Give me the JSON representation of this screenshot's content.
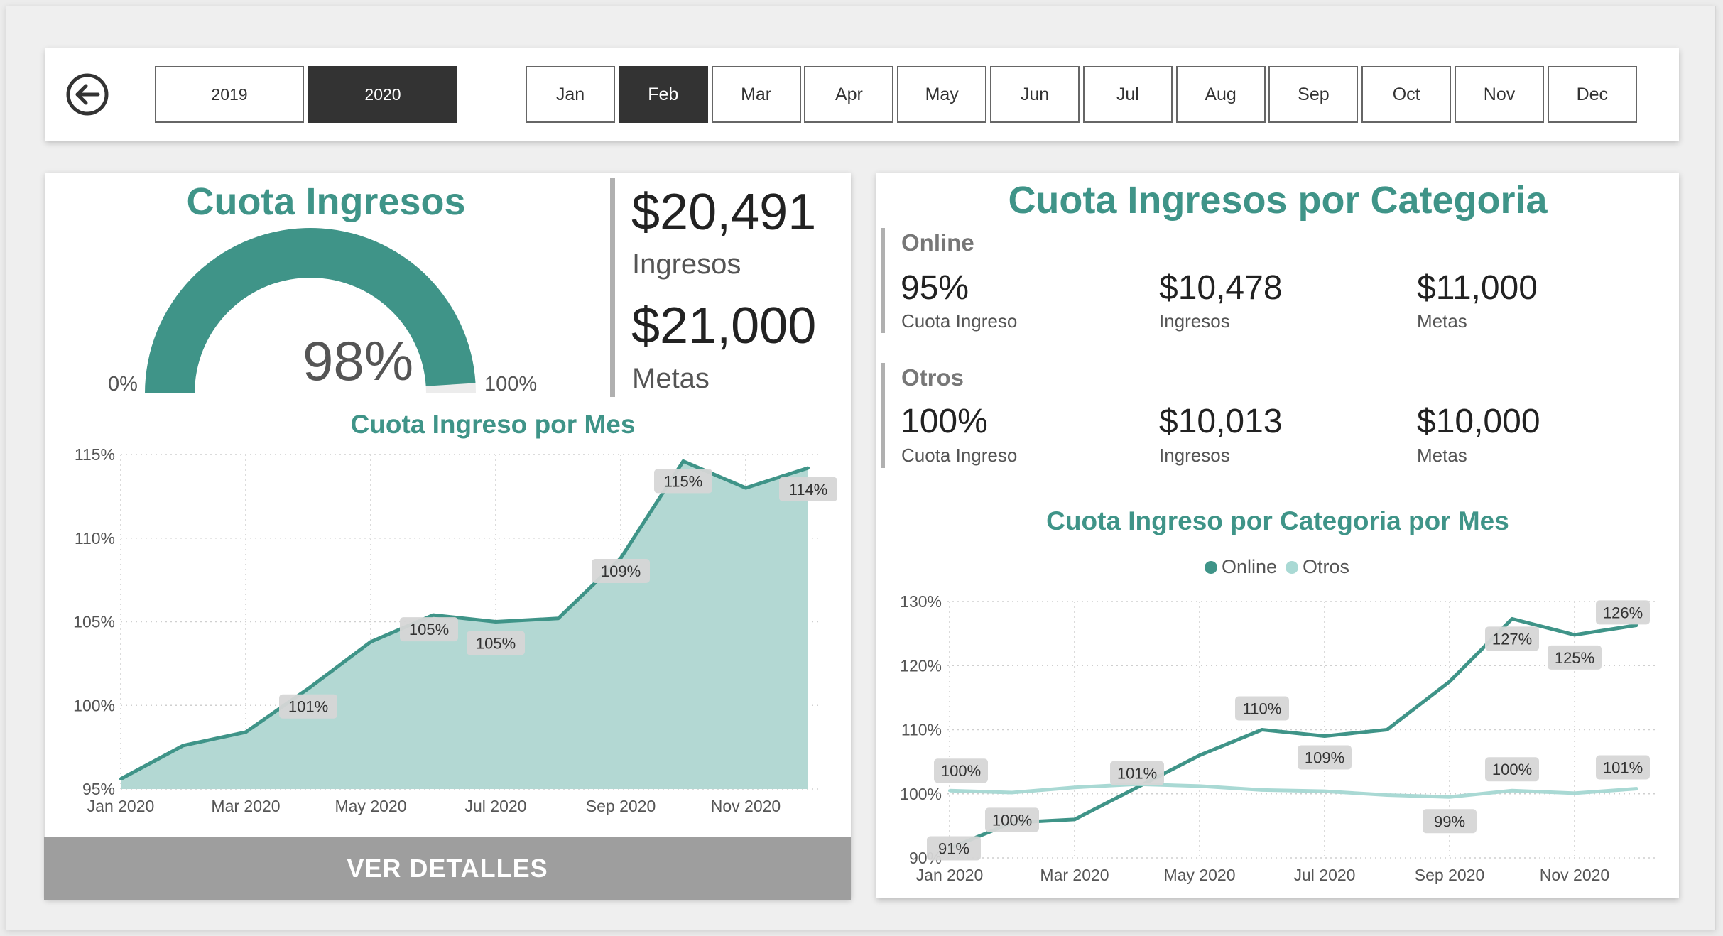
{
  "slicers": {
    "years": [
      {
        "label": "2019",
        "selected": false
      },
      {
        "label": "2020",
        "selected": true
      }
    ],
    "months": [
      {
        "label": "Jan",
        "selected": false
      },
      {
        "label": "Feb",
        "selected": true
      },
      {
        "label": "Mar",
        "selected": false
      },
      {
        "label": "Apr",
        "selected": false
      },
      {
        "label": "May",
        "selected": false
      },
      {
        "label": "Jun",
        "selected": false
      },
      {
        "label": "Jul",
        "selected": false
      },
      {
        "label": "Aug",
        "selected": false
      },
      {
        "label": "Sep",
        "selected": false
      },
      {
        "label": "Oct",
        "selected": false
      },
      {
        "label": "Nov",
        "selected": false
      },
      {
        "label": "Dec",
        "selected": false
      }
    ],
    "back_icon": "arrow-left-circle-icon"
  },
  "left": {
    "title": "Cuota Ingresos",
    "gauge": {
      "value_label": "98%",
      "value": 0.98,
      "min_label": "0%",
      "max_label": "100%"
    },
    "ingresos_value": "$20,491",
    "ingresos_label": "Ingresos",
    "metas_value": "$21,000",
    "metas_label": "Metas",
    "button_label": "VER DETALLES"
  },
  "right": {
    "title": "Cuota Ingresos por Categoria",
    "categories": [
      {
        "name": "Online",
        "cuota": "95%",
        "cuota_label": "Cuota Ingreso",
        "ingresos": "$10,478",
        "ingresos_label": "Ingresos",
        "metas": "$11,000",
        "metas_label": "Metas"
      },
      {
        "name": "Otros",
        "cuota": "100%",
        "cuota_label": "Cuota Ingreso",
        "ingresos": "$10,013",
        "ingresos_label": "Ingresos",
        "metas": "$10,000",
        "metas_label": "Metas"
      }
    ]
  },
  "colors": {
    "accent": "#3f9488",
    "area_fill": "#b3d8d3",
    "light_series": "#a9d9d4",
    "label_bg": "#d9d9d9"
  },
  "chart_data": [
    {
      "type": "area",
      "title": "Cuota Ingreso por Mes",
      "x": [
        "Jan 2020",
        "Feb 2020",
        "Mar 2020",
        "Apr 2020",
        "May 2020",
        "Jun 2020",
        "Jul 2020",
        "Aug 2020",
        "Sep 2020",
        "Oct 2020",
        "Nov 2020",
        "Dec 2020"
      ],
      "x_tick_labels": [
        "Jan 2020",
        "Mar 2020",
        "May 2020",
        "Jul 2020",
        "Sep 2020",
        "Nov 2020"
      ],
      "values": [
        95.6,
        97.6,
        98.4,
        101.0,
        103.8,
        105.4,
        105.0,
        105.2,
        108.8,
        114.6,
        113.0,
        114.2
      ],
      "data_labels": [
        null,
        null,
        null,
        "101%",
        null,
        "105%",
        "105%",
        null,
        "109%",
        "115%",
        null,
        "114%"
      ],
      "ylim": [
        95,
        115
      ],
      "y_ticks": [
        "95%",
        "100%",
        "105%",
        "110%",
        "115%"
      ],
      "grid": true
    },
    {
      "type": "line",
      "title": "Cuota Ingreso por Categoria por Mes",
      "x": [
        "Jan 2020",
        "Feb 2020",
        "Mar 2020",
        "Apr 2020",
        "May 2020",
        "Jun 2020",
        "Jul 2020",
        "Aug 2020",
        "Sep 2020",
        "Oct 2020",
        "Nov 2020",
        "Dec 2020"
      ],
      "x_tick_labels": [
        "Jan 2020",
        "Mar 2020",
        "May 2020",
        "Jul 2020",
        "Sep 2020",
        "Nov 2020"
      ],
      "legend": [
        "Online",
        "Otros"
      ],
      "legend_position": "top-center",
      "series": [
        {
          "name": "Online",
          "color": "#3f9488",
          "values": [
            91.5,
            95.5,
            96.0,
            101.0,
            106.0,
            110.0,
            109.0,
            110.0,
            117.5,
            127.3,
            124.8,
            126.3
          ],
          "data_labels": [
            "91%",
            "100%",
            null,
            "101%",
            null,
            "110%",
            "109%",
            null,
            null,
            "127%",
            "125%",
            "126%"
          ]
        },
        {
          "name": "Otros",
          "color": "#a9d9d4",
          "values": [
            100.5,
            100.2,
            101.0,
            101.5,
            101.2,
            100.6,
            100.4,
            99.8,
            99.5,
            100.5,
            100.1,
            100.8
          ],
          "data_labels": [
            "100%",
            null,
            null,
            null,
            null,
            null,
            null,
            null,
            "99%",
            "100%",
            null,
            "101%"
          ]
        }
      ],
      "ylim": [
        90,
        130
      ],
      "y_ticks": [
        "90%",
        "100%",
        "110%",
        "120%",
        "130%"
      ],
      "grid": true
    }
  ]
}
